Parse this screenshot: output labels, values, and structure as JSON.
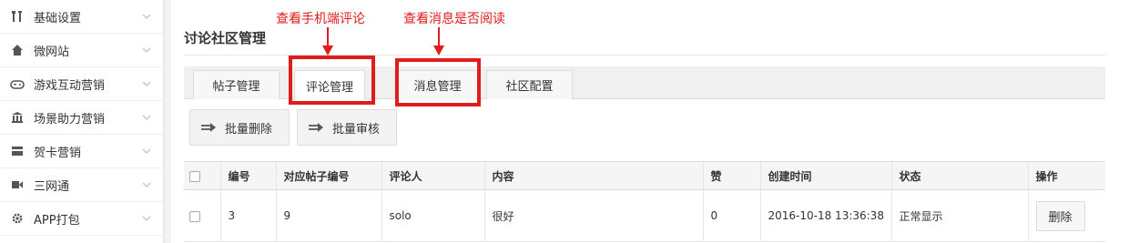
{
  "sidebar": {
    "items": [
      {
        "label": "基础设置",
        "icon": "tools-icon"
      },
      {
        "label": "微网站",
        "icon": "home-icon"
      },
      {
        "label": "游戏互动营销",
        "icon": "gamepad-icon"
      },
      {
        "label": "场景助力营销",
        "icon": "bank-icon"
      },
      {
        "label": "贺卡营销",
        "icon": "card-icon"
      },
      {
        "label": "三网通",
        "icon": "video-camera-icon"
      },
      {
        "label": "APP打包",
        "icon": "gear-icon"
      }
    ]
  },
  "page": {
    "title": "讨论社区管理"
  },
  "tabs": [
    {
      "label": "帖子管理"
    },
    {
      "label": "评论管理"
    },
    {
      "label": "消息管理"
    },
    {
      "label": "社区配置"
    }
  ],
  "toolbar": {
    "batch_delete_label": "批量删除",
    "batch_review_label": "批量审核"
  },
  "table": {
    "headers": [
      "编号",
      "对应帖子编号",
      "评论人",
      "内容",
      "赞",
      "创建时间",
      "状态",
      "操作"
    ],
    "rows": [
      {
        "id": "3",
        "post_id": "9",
        "commenter": "solo",
        "content": "很好",
        "likes": "0",
        "created": "2016-10-18 13:36:38",
        "status": "正常显示",
        "action": "删除"
      }
    ]
  },
  "annotations": {
    "comments_note": "查看手机端评论",
    "messages_note": "查看消息是否阅读",
    "color": "#e21b1b"
  }
}
